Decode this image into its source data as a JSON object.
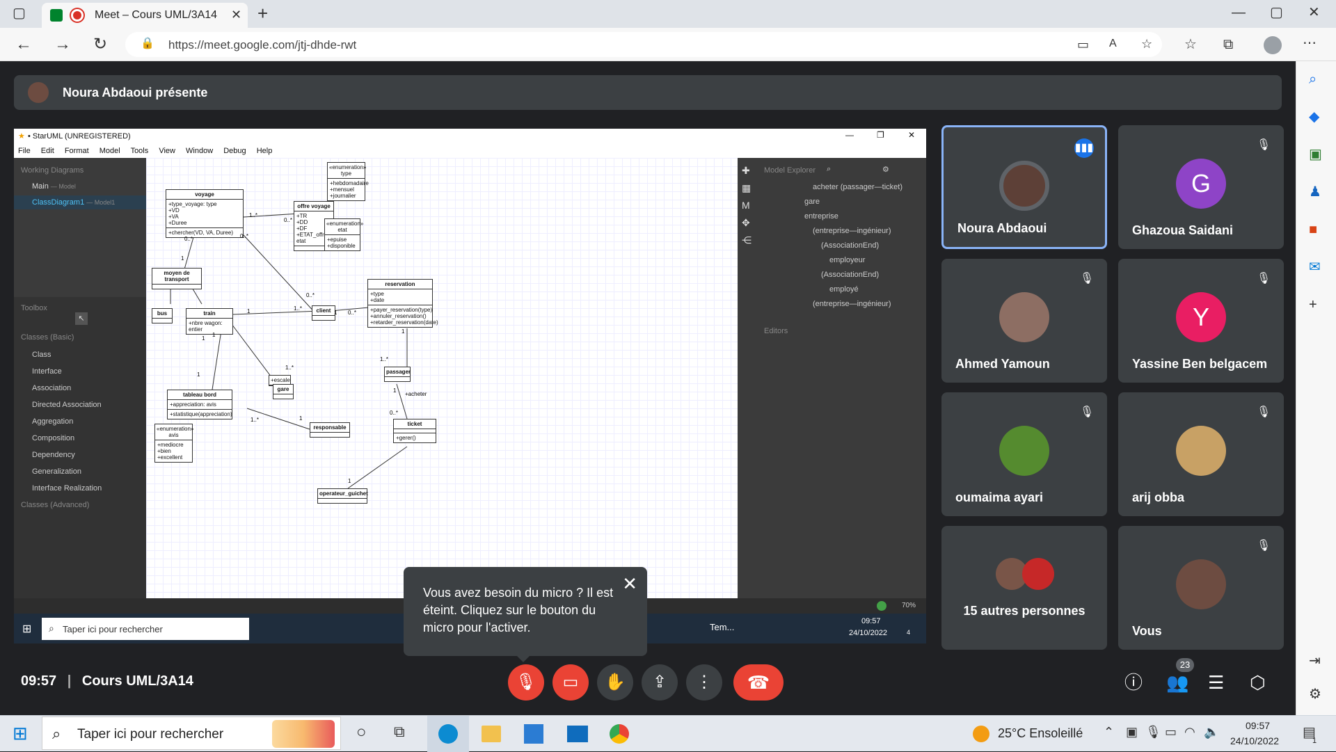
{
  "browser": {
    "tab_title": "Meet – Cours UML/3A14",
    "url": "https://meet.google.com/jtj-dhde-rwt"
  },
  "presenter": {
    "label": "Noura Abdaoui présente"
  },
  "staruml": {
    "title": "• StarUML (UNREGISTERED)",
    "menu": [
      "File",
      "Edit",
      "Format",
      "Model",
      "Tools",
      "View",
      "Window",
      "Debug",
      "Help"
    ],
    "working_diagrams": "Working Diagrams",
    "diagram_main": "Main",
    "diagram_main_sub": "— Model",
    "diagram_class": "ClassDiagram1",
    "diagram_class_sub": "— Model1",
    "toolbox": "Toolbox",
    "classes_basic": "Classes (Basic)",
    "classes_advanced": "Classes (Advanced)",
    "tools": [
      "Class",
      "Interface",
      "Association",
      "Directed Association",
      "Aggregation",
      "Composition",
      "Dependency",
      "Generalization",
      "Interface Realization"
    ],
    "model_explorer": "Model Explorer",
    "editors": "Editors",
    "explorer_items": [
      "acheter (passager—ticket)",
      "gare",
      "entreprise",
      "(entreprise—ingénieur)",
      "(AssociationEnd)",
      "employeur",
      "(AssociationEnd)",
      "employé",
      "(entreprise—ingénieur)"
    ],
    "zoom": "70%",
    "inner_search": "Taper ici pour rechercher",
    "inner_tray_label": "Tem...",
    "inner_time": "09:57",
    "inner_date": "24/10/2022",
    "inner_notif": "4",
    "classes": {
      "voyage": {
        "name": "voyage",
        "attrs": [
          "+type_voyage: type",
          "+VD",
          "+VA",
          "+Duree"
        ],
        "ops": [
          "+chercher(VD, VA, Duree)"
        ]
      },
      "offre": {
        "name": "offre voyage",
        "attrs": [
          "+TR",
          "+DD",
          "+DF",
          "+ETAT_offre: etat"
        ],
        "ops": []
      },
      "enum_type": {
        "stereo": "«enumeration»",
        "name": "type",
        "attrs": [
          "+hebdomadaire",
          "+mensuel",
          "+journalier"
        ]
      },
      "enum_etat": {
        "stereo": "«enumeration»",
        "name": "etat",
        "attrs": [
          "+epuise",
          "+disponible"
        ]
      },
      "moyen": {
        "name": "moyen de transport"
      },
      "bus": {
        "name": "bus"
      },
      "train": {
        "name": "train",
        "attrs": [
          "+nbre wagon: entier"
        ]
      },
      "client": {
        "name": "client"
      },
      "reservation": {
        "name": "reservation",
        "attrs": [
          "+type",
          "+date"
        ],
        "ops": [
          "+payer_reservation(type)",
          "+annuler_reservation()",
          "+retarder_reservation(date)"
        ]
      },
      "passager": {
        "name": "passager"
      },
      "escale": {
        "name": "+escale"
      },
      "gare": {
        "name": "gare"
      },
      "tableau": {
        "name": "tableau bord",
        "attrs": [
          "+appreciation: avis"
        ],
        "ops": [
          "+statistique(appreciation)"
        ]
      },
      "responsable": {
        "name": "responsable"
      },
      "ticket": {
        "name": "ticket",
        "ops": [
          "+gerer()"
        ]
      },
      "enum_avis": {
        "stereo": "«enumeration»",
        "name": "avis",
        "attrs": [
          "+mediocre",
          "+bien",
          "+excellent"
        ]
      },
      "operateur": {
        "name": "operateur_guichet"
      }
    },
    "multiplicities": [
      "1..*",
      "0..*",
      "0..*",
      "0..*",
      "1",
      "1",
      "1",
      "1..*",
      "0..*",
      "1",
      "0..*",
      "1",
      "1",
      "1..*",
      "1",
      "1..*",
      "1",
      "0..*",
      "1",
      "1..*",
      "1"
    ],
    "acheter_label": "+acheter"
  },
  "participants": [
    {
      "name": "Noura Abdaoui",
      "speaking": true
    },
    {
      "name": "Ghazoua Saidani",
      "letter": "G",
      "color": "#8e44c7"
    },
    {
      "name": "Ahmed Yamoun"
    },
    {
      "name": "Yassine Ben belgacem",
      "letter": "Y",
      "color": "#e91e63"
    },
    {
      "name": "oumaima ayari"
    },
    {
      "name": "arij obba"
    },
    {
      "name": "15 autres personnes"
    },
    {
      "name": "Vous"
    }
  ],
  "meeting": {
    "time": "09:57",
    "separator": "|",
    "title": "Cours UML/3A14",
    "people_count": "23"
  },
  "tooltip": {
    "text": "Vous avez besoin du micro ? Il est éteint. Cliquez sur le bouton du micro pour l'activer."
  },
  "taskbar": {
    "search_placeholder": "Taper ici pour rechercher",
    "weather": "25°C  Ensoleillé",
    "time": "09:57",
    "date": "24/10/2022",
    "notif_count": "1"
  }
}
